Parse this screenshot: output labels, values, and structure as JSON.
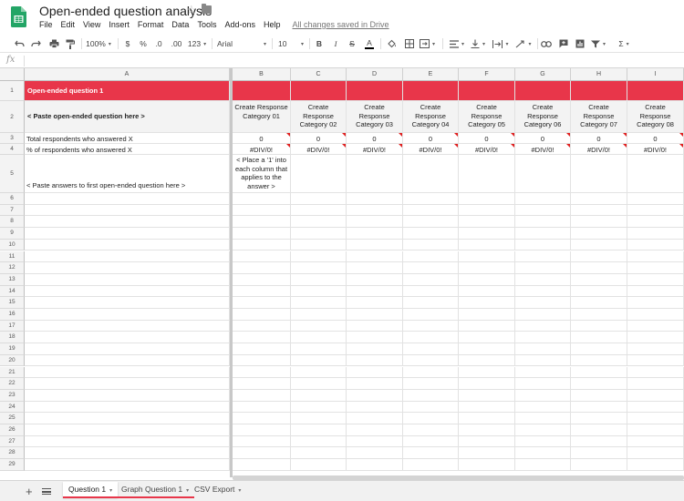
{
  "document": {
    "title": "Open-ended question analysis",
    "save_status": "All changes saved in Drive"
  },
  "menu": [
    "File",
    "Edit",
    "View",
    "Insert",
    "Format",
    "Data",
    "Tools",
    "Add-ons",
    "Help"
  ],
  "toolbar": {
    "zoom": "100%",
    "currency": "$",
    "percent": "%",
    "decrease_decimal": ".0",
    "increase_decimal": ".00",
    "more_formats": "123",
    "font": "Arial",
    "font_size": "10",
    "bold": "B",
    "italic": "I",
    "strikethrough": "S",
    "text_color": "A",
    "sum": "Σ"
  },
  "formula_bar": {
    "fx_label": "fx",
    "value": ""
  },
  "columns": [
    "A",
    "B",
    "C",
    "D",
    "E",
    "F",
    "G",
    "H",
    "I"
  ],
  "rows": [
    "1",
    "2",
    "3",
    "4",
    "5",
    "6",
    "7",
    "8",
    "9",
    "10",
    "11",
    "12",
    "13",
    "14",
    "15",
    "16",
    "17",
    "18",
    "19",
    "20",
    "21",
    "22",
    "23",
    "24",
    "25",
    "26",
    "27",
    "28",
    "29"
  ],
  "cells": {
    "a1": "Open-ended question 1",
    "a2": "< Paste open-ended question here >",
    "a3": "Total respondents who answered X",
    "a4": "% of respondents who answered X",
    "a5": "< Paste answers to first open-ended question here >",
    "b5": "< Place a '1' into each column that applies to the answer >"
  },
  "categories": [
    "Create Response Category 01",
    "Create Response Category 02",
    "Create Response Category 03",
    "Create Response Category 04",
    "Create Response Category 05",
    "Create Response Category 06",
    "Create Response Category 07",
    "Create Response Category 08"
  ],
  "totals": [
    "0",
    "0",
    "0",
    "0",
    "0",
    "0",
    "0",
    "0"
  ],
  "percents": [
    "#DIV/0!",
    "#DIV/0!",
    "#DIV/0!",
    "#DIV/0!",
    "#DIV/0!",
    "#DIV/0!",
    "#DIV/0!",
    "#DIV/0!"
  ],
  "sheets": [
    {
      "name": "Question 1",
      "active": true
    },
    {
      "name": "Graph Question 1",
      "active": false
    },
    {
      "name": "CSV Export",
      "active": false
    }
  ],
  "colors": {
    "accent": "#e8364a",
    "logo_green": "#23a566",
    "error_flag": "#e02020"
  },
  "icons": [
    "undo-icon",
    "redo-icon",
    "print-icon",
    "paint-format-icon",
    "fill-color-icon",
    "borders-icon",
    "merge-cells-icon",
    "align-horizontal-icon",
    "align-vertical-icon",
    "text-wrap-icon",
    "text-rotation-icon",
    "link-icon",
    "insert-comment-icon",
    "insert-chart-icon",
    "filter-icon",
    "functions-icon"
  ]
}
